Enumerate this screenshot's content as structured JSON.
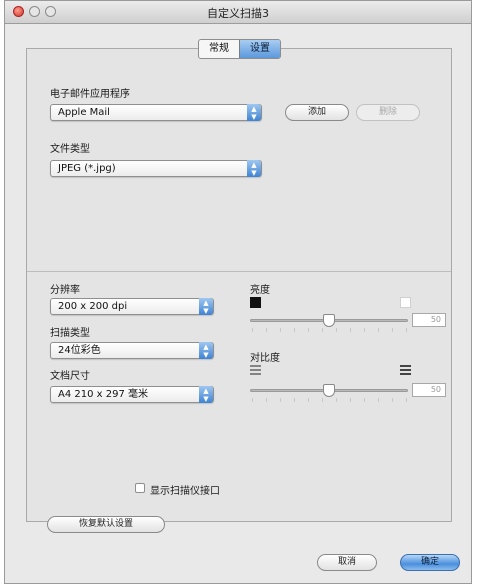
{
  "window": {
    "title": "自定义扫描3"
  },
  "tabs": [
    {
      "label": "常规"
    },
    {
      "label": "设置",
      "active": true
    }
  ],
  "email_app": {
    "label": "电子邮件应用程序",
    "value": "Apple Mail",
    "add_button": "添加",
    "delete_button": "删除"
  },
  "file_type": {
    "label": "文件类型",
    "value": "JPEG (*.jpg)"
  },
  "resolution": {
    "label": "分辨率",
    "value": "200 x 200 dpi"
  },
  "scan_type": {
    "label": "扫描类型",
    "value": "24位彩色"
  },
  "document_size": {
    "label": "文档尺寸",
    "value": "A4  210 x 297 毫米"
  },
  "brightness": {
    "label": "亮度",
    "value": "50",
    "level": 0.5
  },
  "contrast": {
    "label": "对比度",
    "value": "50",
    "level": 0.5
  },
  "show_scanner_interface": {
    "label": "显示扫描仪接口",
    "checked": false
  },
  "restore_defaults_button": "恢复默认设置",
  "cancel_button": "取消",
  "ok_button": "确定",
  "colors": {
    "accent": "#4a8fdc"
  }
}
